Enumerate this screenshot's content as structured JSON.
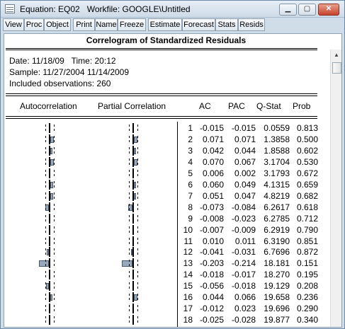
{
  "window": {
    "title": "Equation: EQ02   Workfile: GOOGLE\\Untitled",
    "minimize_label": "▁",
    "maximize_label": "▢",
    "close_label": "✕",
    "app_icon": "document-icon"
  },
  "toolbar": {
    "buttons": [
      "View",
      "Proc",
      "Object",
      "Print",
      "Name",
      "Freeze",
      "Estimate",
      "Forecast",
      "Stats",
      "Resids"
    ]
  },
  "output": {
    "caption": "Correlogram of Standardized Residuals",
    "info_lines": [
      "Date: 11/18/09   Time: 20:12",
      "Sample: 11/27/2004 11/14/2009",
      "Included observations: 260"
    ],
    "headers": {
      "autocorrelation": "Autocorrelation",
      "partial_correlation": "Partial Correlation",
      "ac": "AC",
      "pac": "PAC",
      "qstat": "Q-Stat",
      "prob": "Prob"
    },
    "rows": [
      {
        "lag": "1",
        "ac": "-0.015",
        "pac": "-0.015",
        "q": "0.0559",
        "prob": "0.813"
      },
      {
        "lag": "2",
        "ac": "0.071",
        "pac": "0.071",
        "q": "1.3858",
        "prob": "0.500"
      },
      {
        "lag": "3",
        "ac": "0.042",
        "pac": "0.044",
        "q": "1.8588",
        "prob": "0.602"
      },
      {
        "lag": "4",
        "ac": "0.070",
        "pac": "0.067",
        "q": "3.1704",
        "prob": "0.530"
      },
      {
        "lag": "5",
        "ac": "0.006",
        "pac": "0.002",
        "q": "3.1793",
        "prob": "0.672"
      },
      {
        "lag": "6",
        "ac": "0.060",
        "pac": "0.049",
        "q": "4.1315",
        "prob": "0.659"
      },
      {
        "lag": "7",
        "ac": "0.051",
        "pac": "0.047",
        "q": "4.8219",
        "prob": "0.682"
      },
      {
        "lag": "8",
        "ac": "-0.073",
        "pac": "-0.084",
        "q": "6.2617",
        "prob": "0.618"
      },
      {
        "lag": "9",
        "ac": "-0.008",
        "pac": "-0.023",
        "q": "6.2785",
        "prob": "0.712"
      },
      {
        "lag": "10",
        "ac": "-0.007",
        "pac": "-0.009",
        "q": "6.2919",
        "prob": "0.790"
      },
      {
        "lag": "11",
        "ac": "0.010",
        "pac": "0.011",
        "q": "6.3190",
        "prob": "0.851"
      },
      {
        "lag": "12",
        "ac": "-0.041",
        "pac": "-0.031",
        "q": "6.7696",
        "prob": "0.872"
      },
      {
        "lag": "13",
        "ac": "-0.203",
        "pac": "-0.214",
        "q": "18.181",
        "prob": "0.151"
      },
      {
        "lag": "14",
        "ac": "-0.018",
        "pac": "-0.017",
        "q": "18.270",
        "prob": "0.195"
      },
      {
        "lag": "15",
        "ac": "-0.056",
        "pac": "-0.018",
        "q": "19.129",
        "prob": "0.208"
      },
      {
        "lag": "16",
        "ac": "0.044",
        "pac": "0.066",
        "q": "19.658",
        "prob": "0.236"
      },
      {
        "lag": "17",
        "ac": "-0.012",
        "pac": "0.023",
        "q": "19.696",
        "prob": "0.290"
      },
      {
        "lag": "18",
        "ac": "-0.025",
        "pac": "-0.028",
        "q": "19.877",
        "prob": "0.340"
      }
    ]
  },
  "scrollbar": {
    "up_arrow": "▲"
  },
  "colors": {
    "bar_fill": "#97a9bc",
    "title_bar": "#cddbe8",
    "close_button": "#c7452c"
  }
}
